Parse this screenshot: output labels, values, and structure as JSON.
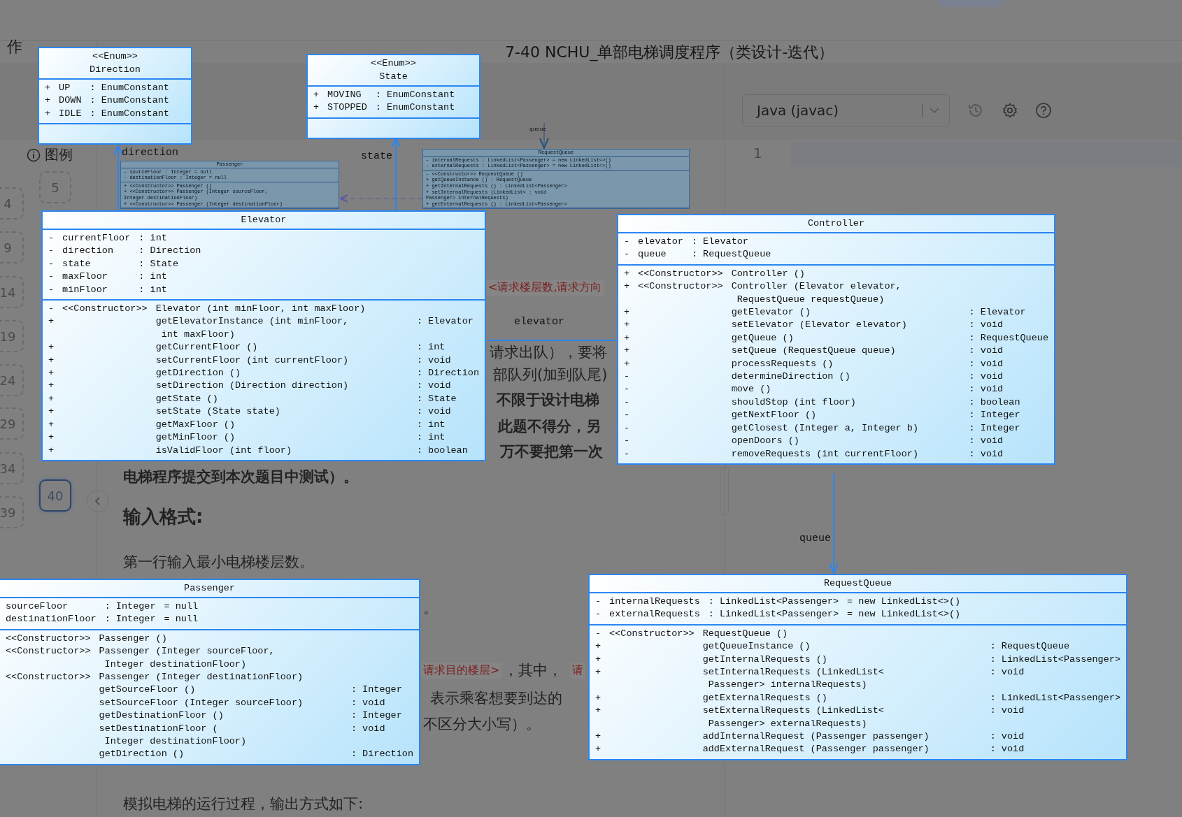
{
  "page": {
    "sidebar_label": "作",
    "legend_label": "图例",
    "title": "7-40 NCHU_单部电梯调度程序（类设计-迭代）",
    "question_tiles": [
      {
        "label": "4",
        "selected": false
      },
      {
        "label": "5",
        "selected": false
      },
      {
        "label": "9",
        "selected": false
      },
      {
        "label": "14",
        "selected": false
      },
      {
        "label": "19",
        "selected": false
      },
      {
        "label": "24",
        "selected": false
      },
      {
        "label": "29",
        "selected": false
      },
      {
        "label": "34",
        "selected": false
      },
      {
        "label": "39",
        "selected": false
      },
      {
        "label": "40",
        "selected": true
      }
    ],
    "fragments": [
      {
        "kind": "tag",
        "text": "<请求楼层数,请求方向"
      },
      {
        "kind": "text",
        "text": "请求出队），要将"
      },
      {
        "kind": "text",
        "text": "部队列(加到队尾)"
      },
      {
        "kind": "bold",
        "text": "不限于设计电梯"
      },
      {
        "kind": "bold",
        "text": "此题不得分，另"
      },
      {
        "kind": "bold",
        "text": "万不要把第一次"
      },
      {
        "kind": "bold",
        "text": "电梯程序提交到本次题目中测试）。"
      },
      {
        "kind": "heading",
        "text": "输入格式:"
      },
      {
        "kind": "text",
        "text": "第一行输入最小电梯楼层数。"
      },
      {
        "kind": "text",
        "text": "。"
      },
      {
        "kind": "tag",
        "text": "请求目的楼层>"
      },
      {
        "kind": "text",
        "text": "，其中，"
      },
      {
        "kind": "tag",
        "text": "请"
      },
      {
        "kind": "text",
        "text": "表示乘客想要到达的"
      },
      {
        "kind": "text",
        "text": "不区分大小写）。"
      },
      {
        "kind": "text",
        "text": "模拟电梯的运行过程，输出方式如下:"
      }
    ]
  },
  "editor": {
    "language": "Java (javac)",
    "line_numbers": [
      "1"
    ]
  },
  "diagram": {
    "thumbnails": [
      {
        "name": "Passenger",
        "attributes": [
          "- sourceFloor : Integer = null",
          "- destinationFloor : Integer = null"
        ],
        "operations": [
          "+ <<Constructor>> Passenger ()",
          "+ <<Constructor>> Passenger (Integer sourceFloor,",
          "Integer destinationFloor)",
          "+ <<Constructor>> Passenger (Integer destinationFloor)"
        ]
      },
      {
        "name": "RequestQueue",
        "attributes": [
          "- internalRequests : LinkedList<Passenger> = new LinkedList<>()",
          "- externalRequests : LinkedList<Passenger> = new LinkedList<>()"
        ],
        "operations": [
          "- <<Constructor>> RequestQueue ()",
          "+ getQueueInstance () : RequestQueue",
          "+ getInternalRequests () : LinkedList<Passenger>",
          "+ setInternalRequests (LinkedList< : void",
          "Passenger> internalRequests)",
          "+ getExternalRequests () : LinkedList<Passenger>"
        ]
      }
    ],
    "labels": [
      {
        "kind": "big",
        "text": "direction"
      },
      {
        "kind": "big",
        "text": "state"
      },
      {
        "kind": "small",
        "text": "queue"
      },
      {
        "kind": "big",
        "text": "elevator"
      },
      {
        "kind": "big",
        "text": "queue"
      }
    ],
    "classes": [
      {
        "stereotype": "<<Enum>>",
        "name": "Direction",
        "attributes": [
          {
            "vis": "+",
            "name": "UP",
            "type": ": EnumConstant"
          },
          {
            "vis": "+",
            "name": "DOWN",
            "type": ": EnumConstant"
          },
          {
            "vis": "+",
            "name": "IDLE",
            "type": ": EnumConstant"
          }
        ]
      },
      {
        "stereotype": "<<Enum>>",
        "name": "State",
        "attributes": [
          {
            "vis": "+",
            "name": "MOVING",
            "type": ": EnumConstant"
          },
          {
            "vis": "+",
            "name": "STOPPED",
            "type": ": EnumConstant"
          }
        ]
      },
      {
        "name": "Elevator",
        "attributes": [
          {
            "vis": "-",
            "name": "currentFloor",
            "type": ": int"
          },
          {
            "vis": "-",
            "name": "direction",
            "type": ": Direction"
          },
          {
            "vis": "-",
            "name": "state",
            "type": ": State"
          },
          {
            "vis": "-",
            "name": "maxFloor",
            "type": ": int"
          },
          {
            "vis": "-",
            "name": "minFloor",
            "type": ": int"
          }
        ],
        "operations": [
          {
            "vis": "-",
            "stereotype": "<<Constructor>>",
            "sig": [
              "Elevator (int minFloor, int maxFloor)"
            ]
          },
          {
            "vis": "+",
            "sig": [
              "getElevatorInstance (int minFloor,",
              "int maxFloor)"
            ],
            "type": ": Elevator"
          },
          {
            "vis": "+",
            "sig": [
              "getCurrentFloor ()"
            ],
            "type": ": int"
          },
          {
            "vis": "+",
            "sig": [
              "setCurrentFloor (int currentFloor)"
            ],
            "type": ": void"
          },
          {
            "vis": "+",
            "sig": [
              "getDirection ()"
            ],
            "type": ": Direction"
          },
          {
            "vis": "+",
            "sig": [
              "setDirection (Direction direction)"
            ],
            "type": ": void"
          },
          {
            "vis": "+",
            "sig": [
              "getState ()"
            ],
            "type": ": State"
          },
          {
            "vis": "+",
            "sig": [
              "setState (State state)"
            ],
            "type": ": void"
          },
          {
            "vis": "+",
            "sig": [
              "getMaxFloor ()"
            ],
            "type": ": int"
          },
          {
            "vis": "+",
            "sig": [
              "getMinFloor ()"
            ],
            "type": ": int"
          },
          {
            "vis": "+",
            "sig": [
              "isValidFloor (int floor)"
            ],
            "type": ": boolean"
          }
        ]
      },
      {
        "name": "Controller",
        "attributes": [
          {
            "vis": "-",
            "name": "elevator",
            "type": ": Elevator"
          },
          {
            "vis": "-",
            "name": "queue",
            "type": ": RequestQueue"
          }
        ],
        "operations": [
          {
            "vis": "+",
            "stereotype": "<<Constructor>>",
            "sig": [
              "Controller ()"
            ]
          },
          {
            "vis": "+",
            "stereotype": "<<Constructor>>",
            "sig": [
              "Controller (Elevator elevator,",
              "RequestQueue requestQueue)"
            ]
          },
          {
            "vis": "+",
            "sig": [
              "getElevator ()"
            ],
            "type": ": Elevator"
          },
          {
            "vis": "+",
            "sig": [
              "setElevator (Elevator elevator)"
            ],
            "type": ": void"
          },
          {
            "vis": "+",
            "sig": [
              "getQueue ()"
            ],
            "type": ": RequestQueue"
          },
          {
            "vis": "+",
            "sig": [
              "setQueue (RequestQueue queue)"
            ],
            "type": ": void"
          },
          {
            "vis": "+",
            "sig": [
              "processRequests ()"
            ],
            "type": ": void"
          },
          {
            "vis": "-",
            "sig": [
              "determineDirection ()"
            ],
            "type": ": void"
          },
          {
            "vis": "-",
            "sig": [
              "move ()"
            ],
            "type": ": void"
          },
          {
            "vis": "-",
            "sig": [
              "shouldStop (int floor)"
            ],
            "type": ": boolean"
          },
          {
            "vis": "-",
            "sig": [
              "getNextFloor ()"
            ],
            "type": ": Integer"
          },
          {
            "vis": "-",
            "sig": [
              "getClosest (Integer a, Integer b)"
            ],
            "type": ": Integer"
          },
          {
            "vis": "-",
            "sig": [
              "openDoors ()"
            ],
            "type": ": void"
          },
          {
            "vis": "-",
            "sig": [
              "removeRequests (int currentFloor)"
            ],
            "type": ": void"
          }
        ]
      },
      {
        "name": "Passenger",
        "attributes": [
          {
            "name": "sourceFloor",
            "type": ": Integer",
            "default": "= null"
          },
          {
            "name": "destinationFloor",
            "type": ": Integer",
            "default": "= null"
          }
        ],
        "operations": [
          {
            "stereotype": "<<Constructor>>",
            "sig": [
              "Passenger ()"
            ]
          },
          {
            "stereotype": "<<Constructor>>",
            "sig": [
              "Passenger (Integer sourceFloor,",
              "Integer destinationFloor)"
            ]
          },
          {
            "stereotype": "<<Constructor>>",
            "sig": [
              "Passenger (Integer destinationFloor)"
            ]
          },
          {
            "sig": [
              "getSourceFloor ()"
            ],
            "type": ": Integer"
          },
          {
            "sig": [
              "setSourceFloor (Integer sourceFloor)"
            ],
            "type": ": void"
          },
          {
            "sig": [
              "getDestinationFloor ()"
            ],
            "type": ": Integer"
          },
          {
            "sig": [
              "setDestinationFloor (",
              "Integer destinationFloor)"
            ],
            "type": ": void"
          },
          {
            "sig": [
              "getDirection ()"
            ],
            "type": ": Direction"
          }
        ]
      },
      {
        "name": "RequestQueue",
        "attributes": [
          {
            "vis": "-",
            "name": "internalRequests",
            "type": ": LinkedList<Passenger>",
            "default": "= new LinkedList<>()"
          },
          {
            "vis": "-",
            "name": "externalRequests",
            "type": ": LinkedList<Passenger>",
            "default": "= new LinkedList<>()"
          }
        ],
        "operations": [
          {
            "vis": "-",
            "stereotype": "<<Constructor>>",
            "sig": [
              "RequestQueue ()"
            ]
          },
          {
            "vis": "+",
            "sig": [
              "getQueueInstance ()"
            ],
            "type": ": RequestQueue"
          },
          {
            "vis": "+",
            "sig": [
              "getInternalRequests ()"
            ],
            "type": ": LinkedList<Passenger>"
          },
          {
            "vis": "+",
            "sig": [
              "setInternalRequests (LinkedList<",
              "Passenger> internalRequests)"
            ],
            "type": ": void"
          },
          {
            "vis": "+",
            "sig": [
              "getExternalRequests ()"
            ],
            "type": ": LinkedList<Passenger>"
          },
          {
            "vis": "+",
            "sig": [
              "setExternalRequests (LinkedList<",
              "Passenger> externalRequests)"
            ],
            "type": ": void"
          },
          {
            "vis": "+",
            "sig": [
              "addInternalRequest (Passenger passenger)"
            ],
            "type": ": void"
          },
          {
            "vis": "+",
            "sig": [
              "addExternalRequest (Passenger passenger)"
            ],
            "type": ": void"
          }
        ]
      }
    ]
  }
}
